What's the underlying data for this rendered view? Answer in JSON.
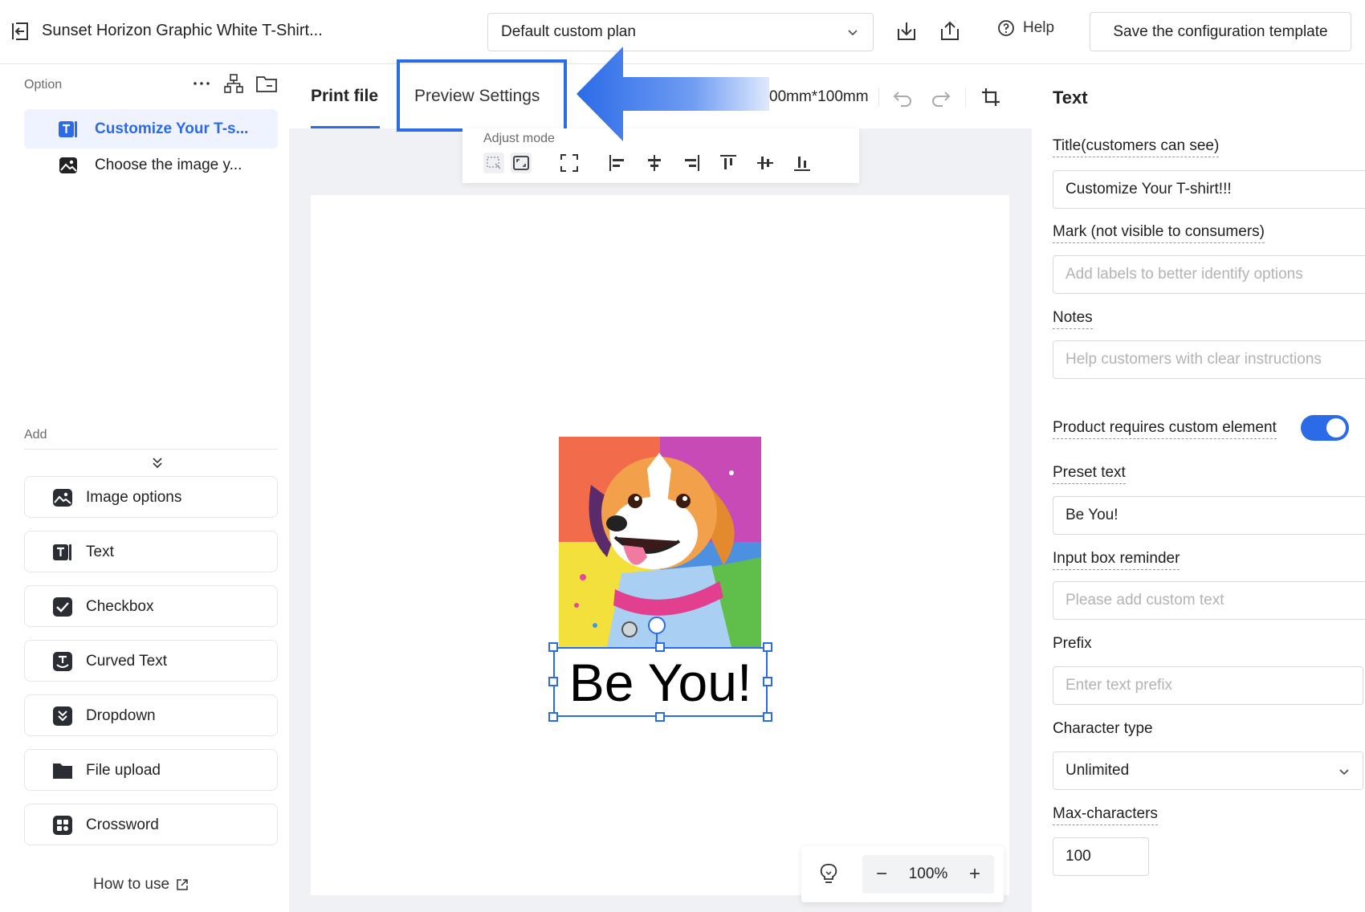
{
  "header": {
    "title": "Sunset Horizon Graphic White T-Shirt...",
    "plan_select": "Default custom plan",
    "help_label": "Help",
    "save_template_label": "Save the configuration template"
  },
  "left": {
    "option_heading": "Option",
    "options": [
      {
        "label": "Customize Your T-s...",
        "icon": "text-icon",
        "active": true
      },
      {
        "label": "Choose the image y...",
        "icon": "image-icon",
        "active": false
      }
    ],
    "add_heading": "Add",
    "add_items": [
      {
        "label": "Image options",
        "icon": "image-icon"
      },
      {
        "label": "Text",
        "icon": "text-icon"
      },
      {
        "label": "Checkbox",
        "icon": "checkbox-icon"
      },
      {
        "label": "Curved Text",
        "icon": "curved-text-icon"
      },
      {
        "label": "Dropdown",
        "icon": "dropdown-icon"
      },
      {
        "label": "File upload",
        "icon": "folder-icon"
      },
      {
        "label": "Crossword",
        "icon": "crossword-icon"
      }
    ],
    "how_to_use": "How to use"
  },
  "canvas": {
    "tabs": [
      {
        "label": "Print file",
        "active": true
      },
      {
        "label": "Preview Settings",
        "active": false
      }
    ],
    "size_label": "00mm*100mm",
    "adjust_mode_label": "Adjust mode",
    "design_text": "Be You!",
    "zoom_level": "100%",
    "zoom_minus": "−",
    "zoom_plus": "+"
  },
  "right": {
    "section_title": "Text",
    "title_label": "Title(customers can see)",
    "title_value": "Customize Your T-shirt!!!",
    "mark_label": "Mark (not visible to consumers)",
    "mark_placeholder": "Add labels to better identify options",
    "notes_label": "Notes",
    "notes_placeholder": "Help customers with clear instructions",
    "requires_label": "Product requires custom element",
    "requires_on": true,
    "preset_label": "Preset text",
    "preset_value": "Be You!",
    "reminder_label": "Input box reminder",
    "reminder_placeholder": "Please add custom text",
    "prefix_label": "Prefix",
    "prefix_placeholder": "Enter text prefix",
    "char_type_label": "Character type",
    "char_type_value": "Unlimited",
    "max_chars_label": "Max-characters",
    "max_chars_value": "100"
  },
  "colors": {
    "accent": "#2b6be8",
    "active_bg": "#eef3ff",
    "canvas_bg": "#f0f1f4"
  }
}
